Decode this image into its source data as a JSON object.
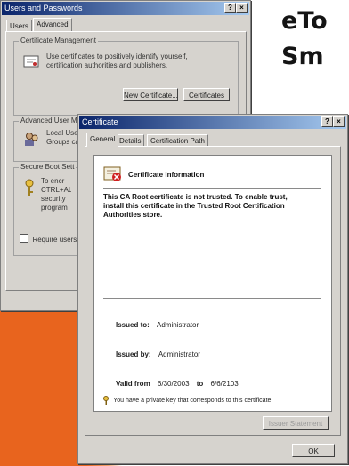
{
  "heading": {
    "line1": "eTo",
    "line2": "Sm"
  },
  "back_window": {
    "title": "Users and Passwords",
    "help_button": "?",
    "close_button": "×",
    "tabs": [
      "Users",
      "Advanced"
    ],
    "cert_group_label": "Certificate Management",
    "cert_text": "Use certificates to positively identify yourself, certification authorities and publishers.",
    "new_cert_button": "New Certificate...",
    "certificates_button": "Certificates",
    "adv_group_label": "Advanced User Management",
    "adv_text": "Local Users and Groups can be used to perform advanced user ma",
    "boot_group_label": "Secure Boot Sett",
    "boot_text": "To encr CTRL+AL security program",
    "require_label": "Require users"
  },
  "front_window": {
    "title": "Certificate",
    "help_button": "?",
    "close_button": "×",
    "tabs": [
      "General",
      "Details",
      "Certification Path"
    ],
    "info_title": "Certificate Information",
    "warning": "This CA Root certificate is not trusted. To enable trust, install this certificate in the Trusted Root Certification Authorities store.",
    "issued_to_label": "Issued to:",
    "issued_to_value": "Administrator",
    "issued_by_label": "Issued by:",
    "issued_by_value": "Administrator",
    "valid_from_label": "Valid from",
    "valid_from_value": "6/30/2003",
    "valid_to_label": "to",
    "valid_to_value": "6/6/2103",
    "private_key_note": "You have a private key that corresponds to this certificate.",
    "issuer_statement_button": "Issuer Statement",
    "ok_button": "OK"
  }
}
